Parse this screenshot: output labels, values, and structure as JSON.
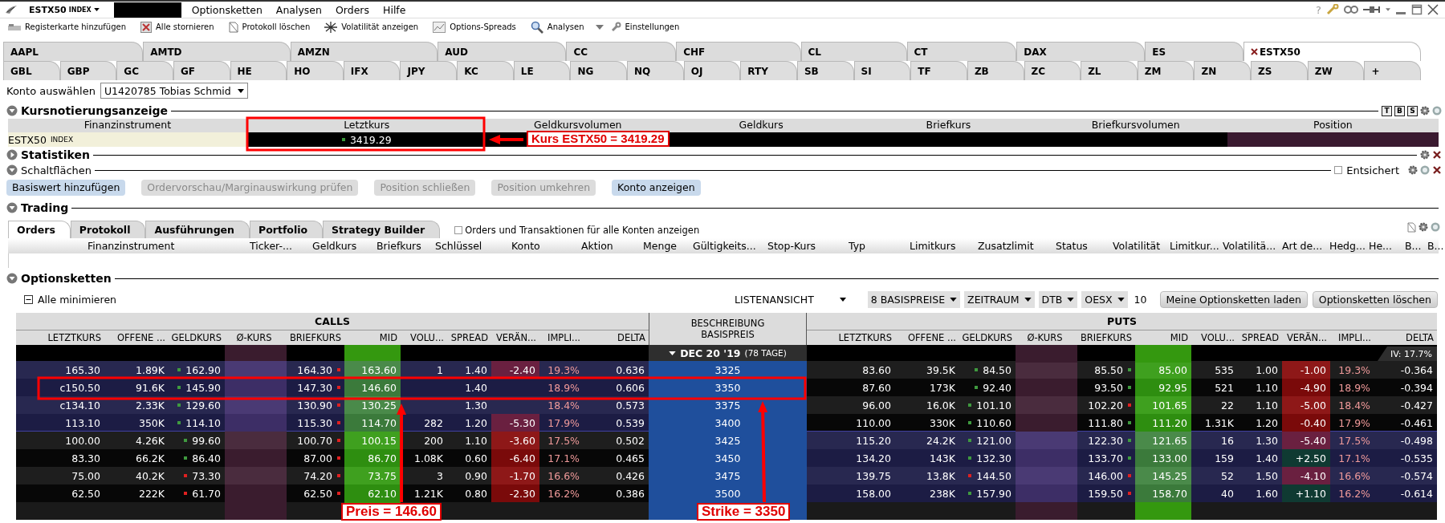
{
  "menubar": {
    "instrument": "ESTX50",
    "instrument_type": "INDEX",
    "menus": [
      "Optionsketten",
      "Analysen",
      "Orders",
      "Hilfe"
    ],
    "help": "?"
  },
  "toolbar": [
    "Registerkarte hinzufügen",
    "Alle stornieren",
    "Protokoll löschen",
    "Volatilität anzeigen",
    "Options-Spreads",
    "Analysen",
    "Einstellungen"
  ],
  "tabs": {
    "row_1": [
      {
        "label": "AAPL",
        "selected": false
      },
      {
        "label": "AMTD",
        "selected": false
      },
      {
        "label": "AMZN",
        "selected": false
      },
      {
        "label": "AUD",
        "selected": false
      },
      {
        "label": "CC",
        "selected": false
      },
      {
        "label": "CHF",
        "selected": false
      },
      {
        "label": "CL",
        "selected": false
      },
      {
        "label": "CT",
        "selected": false
      },
      {
        "label": "DAX",
        "selected": false
      },
      {
        "label": "ES",
        "selected": false
      },
      {
        "label": "ESTX50",
        "selected": true
      }
    ],
    "row_2": [
      {
        "label": "GBL",
        "selected": false
      },
      {
        "label": "GBP",
        "selected": false
      },
      {
        "label": "GC",
        "selected": false
      },
      {
        "label": "GF",
        "selected": false
      },
      {
        "label": "HE",
        "selected": false
      },
      {
        "label": "HO",
        "selected": false
      },
      {
        "label": "IFX",
        "selected": false
      },
      {
        "label": "JPY",
        "selected": false
      },
      {
        "label": "KC",
        "selected": false
      },
      {
        "label": "LE",
        "selected": false
      },
      {
        "label": "NG",
        "selected": false
      },
      {
        "label": "NQ",
        "selected": false
      },
      {
        "label": "OJ",
        "selected": false
      },
      {
        "label": "RTY",
        "selected": false
      },
      {
        "label": "SB",
        "selected": false
      },
      {
        "label": "SI",
        "selected": false
      },
      {
        "label": "TF",
        "selected": false
      },
      {
        "label": "ZB",
        "selected": false
      },
      {
        "label": "ZC",
        "selected": false
      },
      {
        "label": "ZL",
        "selected": false
      },
      {
        "label": "ZM",
        "selected": false
      },
      {
        "label": "ZN",
        "selected": false
      },
      {
        "label": "ZS",
        "selected": false
      },
      {
        "label": "ZW",
        "selected": false
      },
      {
        "label": "+",
        "selected": false
      }
    ]
  },
  "account": {
    "label": "Konto auswählen",
    "value": "U1420785 Tobias Schmid"
  },
  "quote": {
    "title": "Kursnotierungsanzeige",
    "expanded": true,
    "view_buttons": [
      "T",
      "B",
      "S"
    ],
    "columns": [
      "Finanzinstrument",
      "Letztkurs",
      "Geldkursvolumen",
      "Geldkurs",
      "Briefkurs",
      "Briefkursvolumen",
      "Position"
    ],
    "row": {
      "instrument": "ESTX50",
      "instrument_type": "INDEX",
      "last": "3419.29",
      "last_up": true
    }
  },
  "statistics": {
    "title": "Statistiken",
    "expanded": false
  },
  "buttons_panel": {
    "title": "Schaltflächen",
    "expanded": true,
    "safety": {
      "label": "Entsichert",
      "checked": false
    },
    "buttons": [
      {
        "label": "Basiswert hinzufügen",
        "disabled": false
      },
      {
        "label": "Ordervorschau/Marginauswirkung prüfen",
        "disabled": true
      },
      {
        "label": "Position schließen",
        "disabled": true
      },
      {
        "label": "Position umkehren",
        "disabled": true
      },
      {
        "label": "Konto anzeigen",
        "disabled": false
      }
    ]
  },
  "trading": {
    "title": "Trading",
    "expanded": true,
    "tabs": [
      {
        "label": "Orders",
        "selected": true
      },
      {
        "label": "Protokoll",
        "selected": false
      },
      {
        "label": "Ausführungen",
        "selected": false
      },
      {
        "label": "Portfolio",
        "selected": false
      },
      {
        "label": "Strategy Builder",
        "selected": false
      }
    ],
    "show_all": {
      "label": "Orders und Transaktionen für alle Konten anzeigen",
      "checked": false
    },
    "columns": [
      "Finanzinstrument",
      "Ticker-...",
      "Geldkurs",
      "Briefkurs",
      "Schlüssel",
      "Konto",
      "Aktion",
      "Menge",
      "Gültigkeits...",
      "Stop-Kurs",
      "Typ",
      "Limitkurs",
      "Zusatzlimit",
      "Status",
      "Volatilität",
      "Limitkur...",
      "Volatilitä...",
      "Art de...",
      "Hedg...",
      "He...",
      "B...",
      "B..."
    ]
  },
  "option_chains": {
    "title": "Optionsketten",
    "expanded": true,
    "collapse_all": "Alle minimieren",
    "view": "LISTENANSICHT",
    "filters": [
      "8 BASISPREISE",
      "ZEITRAUM",
      "DTB",
      "OESX"
    ],
    "count": "10",
    "buttons": [
      "Meine Optionsketten laden",
      "Optionsketten löschen"
    ],
    "calls_title": "CALLS",
    "puts_title": "PUTS",
    "center_title": "BESCHREIBUNG BASISPREIS",
    "call_columns": [
      "LETZTKURS",
      "OFFENE ...",
      "GELDKURS",
      "Ø-KURS",
      "BRIEFKURS",
      "MID",
      "VOLU...",
      "SPREAD",
      "VERÄN...",
      "IMPLI...",
      "DELTA"
    ],
    "put_columns": [
      "LETZTKURS",
      "OFFENE ...",
      "GELDKURS",
      "Ø-KURS",
      "BRIEFKURS",
      "MID",
      "VOLU...",
      "SPREAD",
      "VERÄN...",
      "IMPLI...",
      "DELTA"
    ],
    "expiry": {
      "label": "DEC 20 '19",
      "days": "(78 TAGE)",
      "expanded": true
    },
    "iv": "IV: 17.7%",
    "rows": [
      {
        "strike": "3325",
        "call": {
          "itm": true,
          "last": "165.30",
          "open_interest": "1.89K",
          "bid": "162.90",
          "bid_up": true,
          "ask": "164.30",
          "ask_up": false,
          "mid": "163.60",
          "volume": "1",
          "spread": "1.40",
          "change": "-2.40",
          "change_up": false,
          "iv": "19.3%",
          "delta": "0.636"
        },
        "put": {
          "itm": false,
          "last": "83.60",
          "open_interest": "39.5K",
          "bid": "84.50",
          "bid_up": true,
          "ask": "85.50",
          "ask_up": true,
          "mid": "85.00",
          "volume": "535",
          "spread": "1.00",
          "change": "-1.00",
          "change_up": false,
          "iv": "19.3%",
          "delta": "-0.364"
        }
      },
      {
        "strike": "3350",
        "call": {
          "itm": true,
          "last": "c150.50",
          "open_interest": "91.6K",
          "bid": "145.90",
          "bid_up": true,
          "ask": "147.30",
          "ask_up": false,
          "mid": "146.60",
          "spread": "1.40",
          "iv": "18.9%",
          "delta": "0.606"
        },
        "put": {
          "itm": false,
          "last": "87.60",
          "open_interest": "173K",
          "bid": "92.40",
          "bid_up": true,
          "ask": "93.50",
          "ask_up": true,
          "mid": "92.95",
          "volume": "521",
          "spread": "1.10",
          "change": "-4.90",
          "change_up": false,
          "iv": "18.9%",
          "delta": "-0.394"
        }
      },
      {
        "strike": "3375",
        "call": {
          "itm": true,
          "last": "c134.10",
          "open_interest": "2.33K",
          "bid": "129.60",
          "bid_up": true,
          "ask": "130.90",
          "ask_up": false,
          "mid": "130.25",
          "spread": "1.30",
          "iv": "18.4%",
          "delta": "0.573"
        },
        "put": {
          "itm": false,
          "last": "96.00",
          "open_interest": "16.0K",
          "bid": "101.10",
          "bid_up": true,
          "ask": "102.20",
          "ask_up": false,
          "mid": "101.65",
          "volume": "22",
          "spread": "1.10",
          "change": "-5.00",
          "change_up": false,
          "iv": "18.4%",
          "delta": "-0.427"
        }
      },
      {
        "strike": "3400",
        "call": {
          "itm": true,
          "last": "113.10",
          "open_interest": "350K",
          "bid": "114.10",
          "bid_up": true,
          "ask": "115.30",
          "ask_up": false,
          "mid": "114.70",
          "volume": "282",
          "spread": "1.20",
          "change": "-5.30",
          "change_up": false,
          "iv": "17.9%",
          "delta": "0.539"
        },
        "put": {
          "itm": false,
          "last": "110.00",
          "open_interest": "330K",
          "bid": "110.60",
          "bid_up": true,
          "ask": "111.80",
          "ask_up": true,
          "mid": "111.20",
          "volume": "1.31K",
          "spread": "1.20",
          "change": "-0.40",
          "change_up": false,
          "iv": "17.9%",
          "delta": "-0.461"
        }
      },
      {
        "strike": "3425",
        "call": {
          "itm": false,
          "last": "100.00",
          "open_interest": "4.26K",
          "bid": "99.60",
          "bid_up": true,
          "ask": "100.70",
          "ask_up": false,
          "mid": "100.15",
          "volume": "200",
          "spread": "1.10",
          "change": "-3.60",
          "change_up": false,
          "iv": "17.5%",
          "delta": "0.502"
        },
        "put": {
          "itm": true,
          "last": "115.20",
          "open_interest": "24.2K",
          "bid": "121.00",
          "bid_up": true,
          "ask": "122.30",
          "ask_up": true,
          "mid": "121.65",
          "volume": "16",
          "spread": "1.30",
          "change": "-5.40",
          "change_up": false,
          "iv": "17.5%",
          "delta": "-0.498"
        }
      },
      {
        "strike": "3450",
        "call": {
          "itm": false,
          "last": "83.30",
          "open_interest": "66.2K",
          "bid": "86.40",
          "bid_up": true,
          "ask": "87.00",
          "ask_up": false,
          "mid": "86.70",
          "volume": "1.08K",
          "spread": "0.60",
          "change": "-6.40",
          "change_up": false,
          "iv": "17.1%",
          "delta": "0.465"
        },
        "put": {
          "itm": true,
          "last": "134.20",
          "open_interest": "143K",
          "bid": "132.30",
          "bid_up": true,
          "ask": "133.70",
          "ask_up": true,
          "mid": "133.00",
          "volume": "159",
          "spread": "1.40",
          "change": "+2.50",
          "change_up": true,
          "iv": "17.1%",
          "delta": "-0.535"
        }
      },
      {
        "strike": "3475",
        "call": {
          "itm": false,
          "last": "75.00",
          "open_interest": "40.2K",
          "bid": "73.30",
          "bid_up": false,
          "ask": "74.20",
          "ask_up": false,
          "mid": "73.75",
          "volume": "3",
          "spread": "0.90",
          "change": "-1.70",
          "change_up": false,
          "iv": "16.6%",
          "delta": "0.426"
        },
        "put": {
          "itm": true,
          "last": "139.75",
          "open_interest": "13.8K",
          "bid": "144.50",
          "bid_up": false,
          "ask": "146.00",
          "ask_up": false,
          "mid": "145.25",
          "volume": "52",
          "spread": "1.50",
          "change": "-4.10",
          "change_up": false,
          "iv": "16.6%",
          "delta": "-0.574"
        }
      },
      {
        "strike": "3500",
        "call": {
          "itm": false,
          "last": "62.50",
          "open_interest": "222K",
          "bid": "61.70",
          "bid_up": false,
          "ask": "62.50",
          "ask_up": false,
          "mid": "62.10",
          "volume": "1.21K",
          "spread": "0.80",
          "change": "-2.30",
          "change_up": false,
          "iv": "16.2%",
          "delta": "0.386"
        },
        "put": {
          "itm": true,
          "last": "158.00",
          "open_interest": "238K",
          "bid": "157.90",
          "bid_up": true,
          "ask": "159.50",
          "ask_up": false,
          "mid": "158.70",
          "volume": "40",
          "spread": "1.60",
          "change": "+1.10",
          "change_up": true,
          "iv": "16.2%",
          "delta": "-0.614"
        }
      }
    ]
  },
  "annotations": [
    {
      "text": "Kurs ESTX50 = 3419.29"
    },
    {
      "text": "Preis = 146.60"
    },
    {
      "text": "Strike = 3350"
    }
  ]
}
